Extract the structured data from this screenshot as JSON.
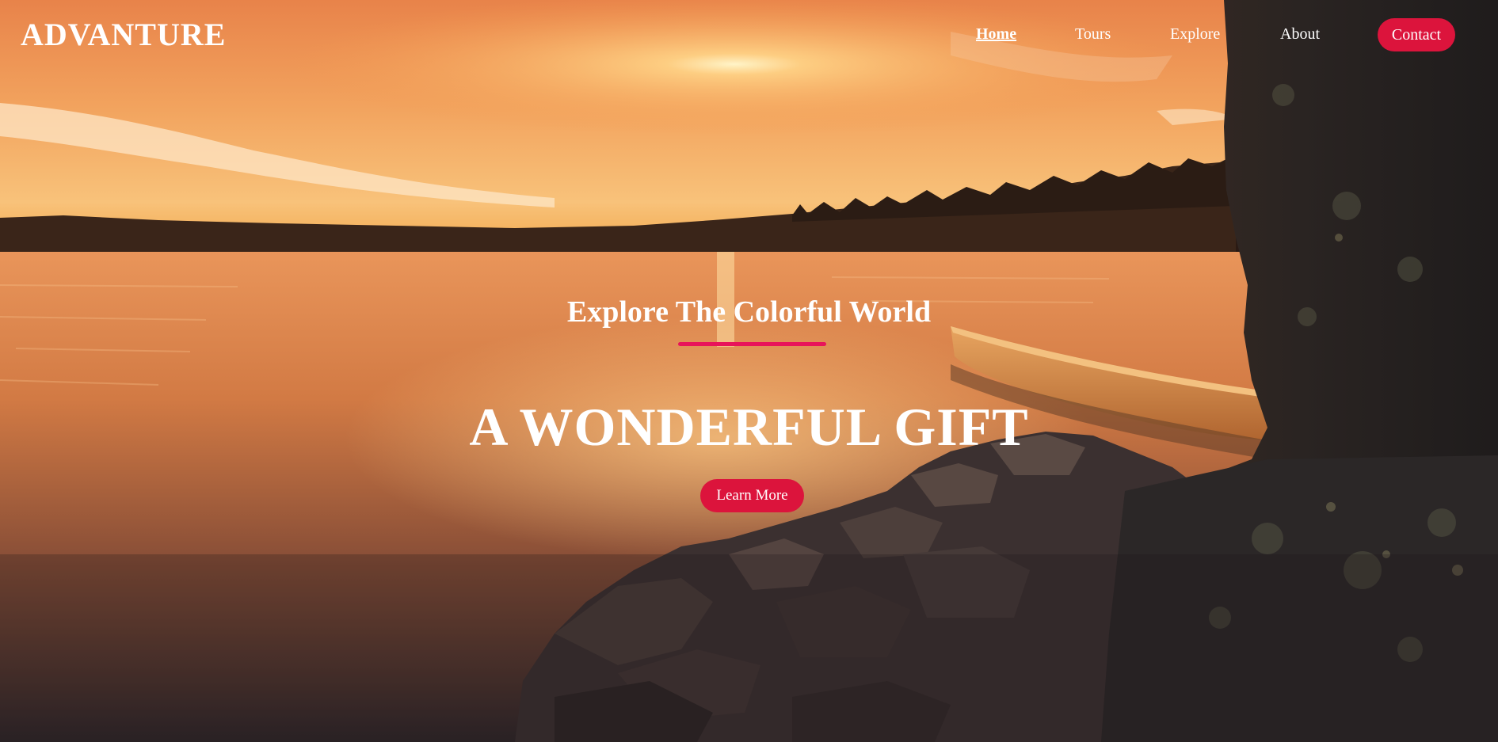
{
  "brand": {
    "logo": "ADVANTURE"
  },
  "nav": {
    "items": [
      {
        "label": "Home",
        "active": true
      },
      {
        "label": "Tours",
        "active": false
      },
      {
        "label": "Explore",
        "active": false
      },
      {
        "label": "About",
        "active": false
      }
    ],
    "contact_label": "Contact"
  },
  "hero": {
    "tagline": "Explore The Colorful World",
    "headline": "A WONDERFUL GIFT",
    "cta_label": "Learn More",
    "background_image": "sunset-lake-canoe-rocks"
  },
  "colors": {
    "accent": "#dc143c",
    "underline": "#e8145a",
    "text": "#ffffff"
  }
}
